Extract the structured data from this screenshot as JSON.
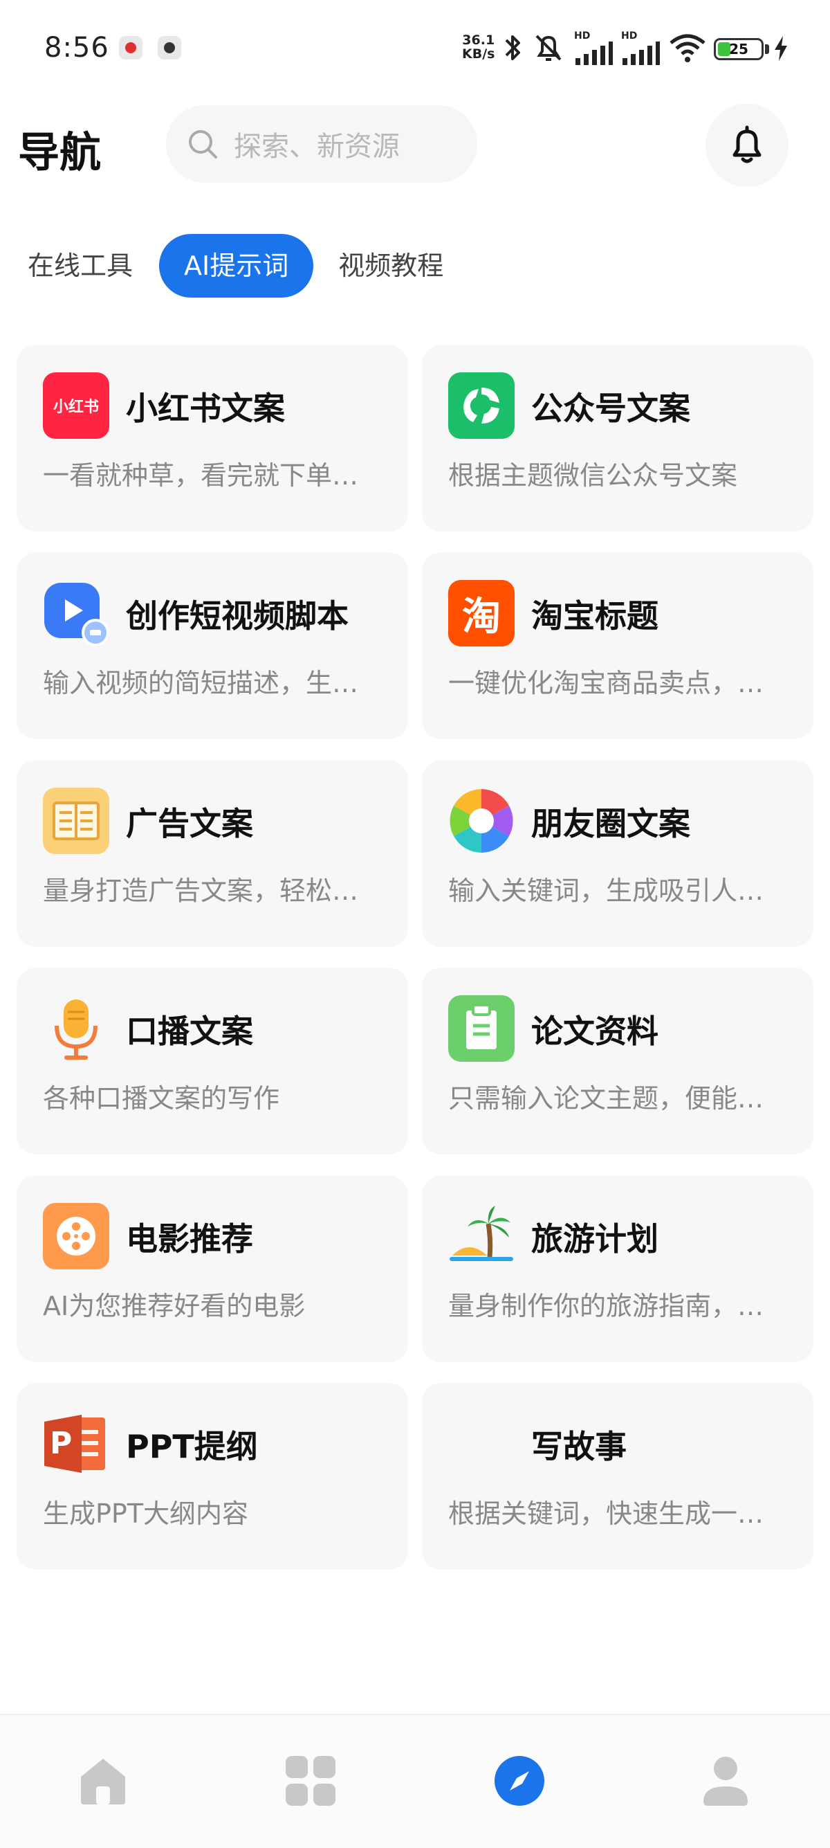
{
  "status_bar": {
    "time": "8:56",
    "net_speed_value": "36.1",
    "net_speed_unit": "KB/s",
    "battery": "25",
    "signal1_label": "HD",
    "signal2_label": "HD"
  },
  "header": {
    "title": "导航",
    "search_placeholder": "探索、新资源"
  },
  "tabs": [
    {
      "label": "在线工具",
      "active": false
    },
    {
      "label": "AI提示词",
      "active": true
    },
    {
      "label": "视频教程",
      "active": false
    }
  ],
  "cards": [
    {
      "title": "小红书文案",
      "desc": "一看就种草，看完就下单…",
      "icon": "xiaohongshu-icon",
      "icon_text": "小红书"
    },
    {
      "title": "公众号文案",
      "desc": "根据主题微信公众号文案",
      "icon": "wechat-official-icon"
    },
    {
      "title": "创作短视频脚本",
      "desc": "输入视频的简短描述，生…",
      "icon": "short-video-icon"
    },
    {
      "title": "淘宝标题",
      "desc": "一键优化淘宝商品卖点，…",
      "icon": "taobao-icon",
      "icon_text": "淘"
    },
    {
      "title": "广告文案",
      "desc": "量身打造广告文案，轻松…",
      "icon": "book-icon"
    },
    {
      "title": "朋友圈文案",
      "desc": "输入关键词，生成吸引人…",
      "icon": "aperture-icon"
    },
    {
      "title": "口播文案",
      "desc": "各种口播文案的写作",
      "icon": "microphone-icon"
    },
    {
      "title": "论文资料",
      "desc": "只需输入论文主题，便能…",
      "icon": "clipboard-icon"
    },
    {
      "title": "电影推荐",
      "desc": "AI为您推荐好看的电影",
      "icon": "film-reel-icon"
    },
    {
      "title": "旅游计划",
      "desc": "量身制作你的旅游指南，…",
      "icon": "palm-tree-icon"
    },
    {
      "title": "PPT提纲",
      "desc": "生成PPT大纲内容",
      "icon": "powerpoint-icon",
      "icon_text": "P"
    },
    {
      "title": "写故事",
      "desc": "根据关键词，快速生成一…",
      "icon": "story-icon"
    }
  ],
  "bottom_nav": [
    {
      "icon": "home-icon",
      "active": false
    },
    {
      "icon": "apps-grid-icon",
      "active": false
    },
    {
      "icon": "compass-icon",
      "active": true
    },
    {
      "icon": "profile-icon",
      "active": false
    }
  ],
  "colors": {
    "accent": "#1b74ea",
    "card_bg": "#f7f7f8",
    "desc_text": "#888888"
  }
}
